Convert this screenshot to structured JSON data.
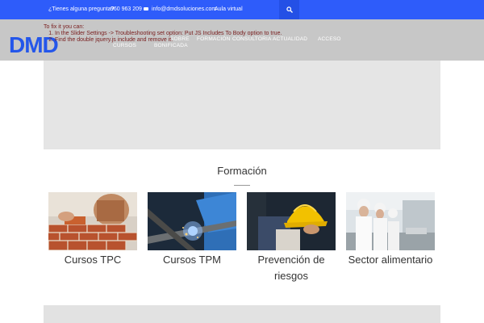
{
  "topbar": {
    "question": "¿Tienes alguna pregunta?",
    "phone": "960 963 209",
    "email": "info@dmdsoluciones.com",
    "virtual": "Aula virtual"
  },
  "brand": {
    "logo": "DMD",
    "color": "#2456ea"
  },
  "nav": {
    "cursos": "CURSOS",
    "bonificada": "BONIFICADA",
    "sobre": "SOBRE",
    "formacion": "FORMACIÓN",
    "consultoria": "CONSULTORIA",
    "actualidad": "ACTUALIDAD",
    "acceso": "ACCESO"
  },
  "slider": {
    "fix_heading": "To fix it you can:",
    "step1": "In the Slider Settings -> Troubleshooting set option: Put JS Includes To Body option to true.",
    "step2": "Find the double jquery.js include and remove it."
  },
  "section": {
    "title": "Formación",
    "cards": [
      {
        "label": "Cursos TPC"
      },
      {
        "label": "Cursos TPM"
      },
      {
        "label": "Prevención de riesgos"
      },
      {
        "label": "Sector alimentario"
      }
    ]
  },
  "colors": {
    "topbar": "#2e5cfa",
    "text": "#333333",
    "error": "#7a2020"
  }
}
